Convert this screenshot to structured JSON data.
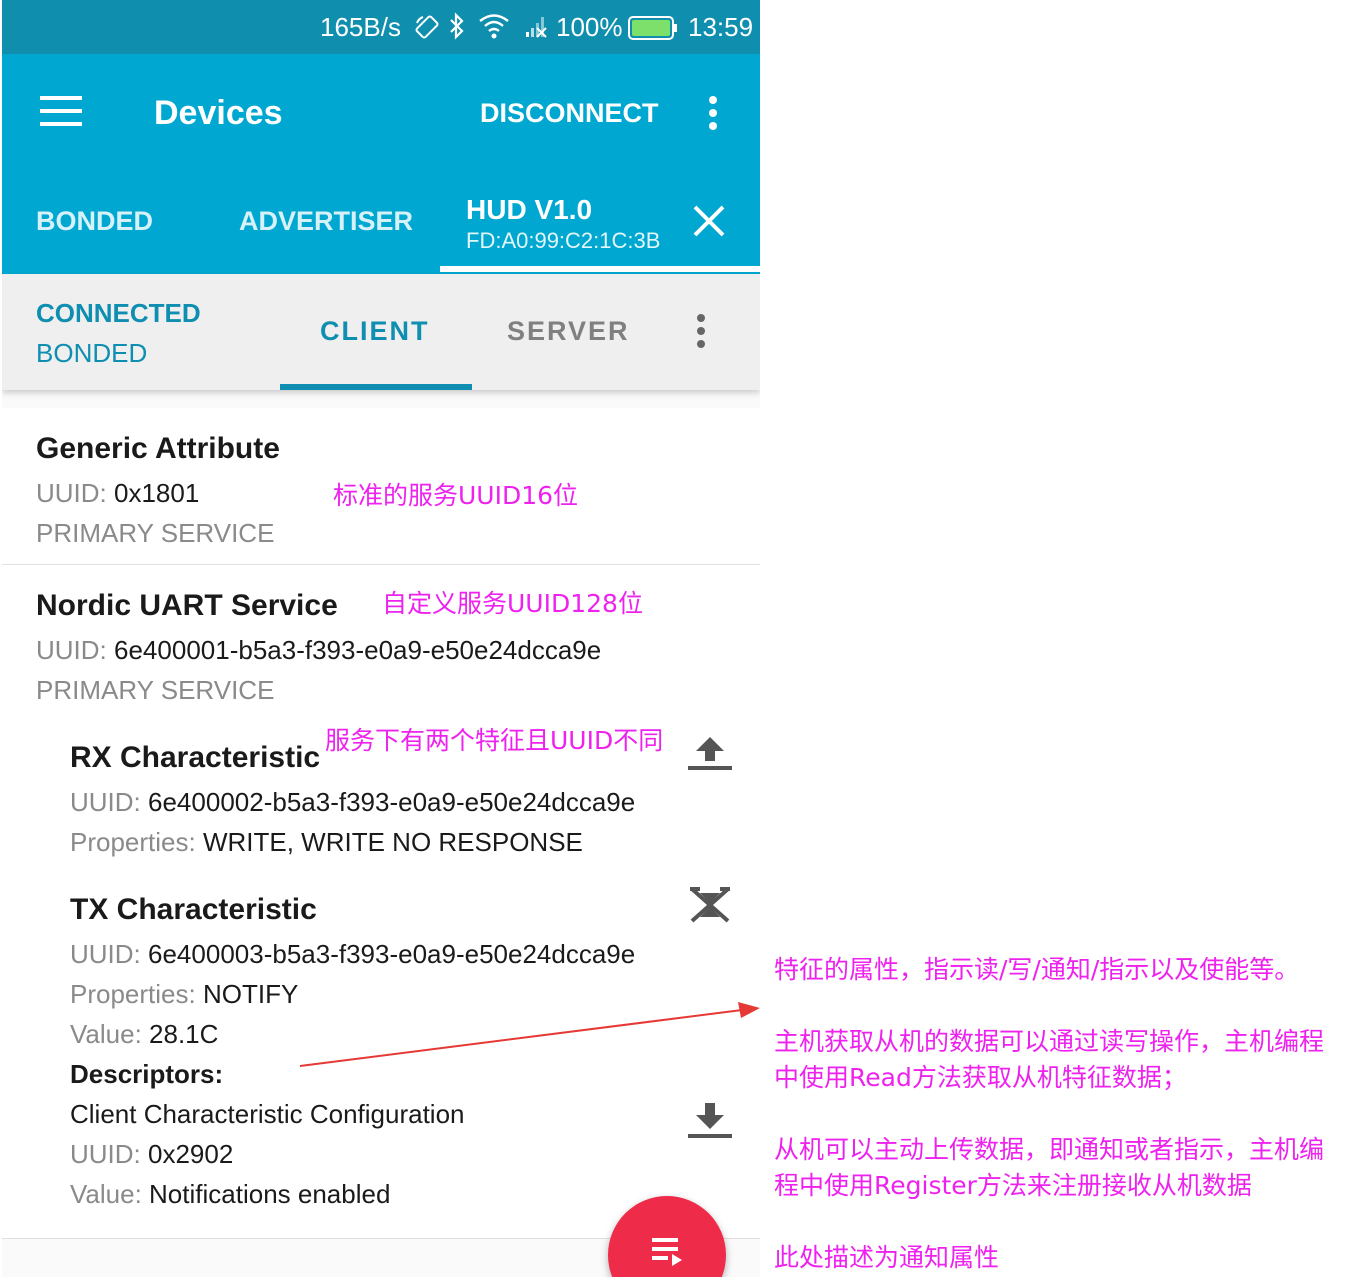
{
  "status_bar": {
    "net_speed": "165B/s",
    "battery": "100%",
    "time": "13:59",
    "bar_color": "#0f8eae"
  },
  "app_bar": {
    "title": "Devices",
    "disconnect_label": "DISCONNECT",
    "color": "#00a8d1",
    "device_tabs": [
      {
        "label": "BONDED"
      },
      {
        "label": "ADVERTISER"
      }
    ],
    "active_device": {
      "name": "HUD V1.0",
      "address": "FD:A0:99:C2:1C:3B"
    }
  },
  "connection": {
    "state": "CONNECTED",
    "bond_state": "BONDED",
    "tabs": [
      {
        "label": "CLIENT",
        "selected": true
      },
      {
        "label": "SERVER",
        "selected": false
      }
    ],
    "accent": "#0e8eb0"
  },
  "services": [
    {
      "name": "Generic Attribute",
      "uuid_label": "UUID:",
      "uuid": "0x1801",
      "type": "PRIMARY SERVICE"
    },
    {
      "name": "Nordic UART Service",
      "uuid_label": "UUID:",
      "uuid": "6e400001-b5a3-f393-e0a9-e50e24dcca9e",
      "type": "PRIMARY SERVICE",
      "characteristics": [
        {
          "name": "RX Characteristic",
          "uuid_label": "UUID:",
          "uuid": "6e400002-b5a3-f393-e0a9-e50e24dcca9e",
          "properties_label": "Properties:",
          "properties": "WRITE, WRITE NO RESPONSE",
          "action_icon": "upload-icon"
        },
        {
          "name": "TX Characteristic",
          "uuid_label": "UUID:",
          "uuid": "6e400003-b5a3-f393-e0a9-e50e24dcca9e",
          "properties_label": "Properties:",
          "properties": "NOTIFY",
          "value_label": "Value:",
          "value": "28.1C",
          "action_icon": "notifications-off-icon",
          "descriptors_label": "Descriptors:",
          "descriptors": [
            {
              "name": "Client Characteristic Configuration",
              "uuid_label": "UUID:",
              "uuid": "0x2902",
              "value_label": "Value:",
              "value": "Notifications enabled",
              "action_icon": "download-icon"
            }
          ]
        }
      ]
    }
  ],
  "fab": {
    "icon": "log-icon",
    "color": "#ee2c4a"
  },
  "annotations": {
    "color": "#ee22ee",
    "standard_service": "标准的服务UUID16位",
    "custom_service": "自定义服务UUID128位",
    "two_characteristics": "服务下有两个特征且UUID不同",
    "properties_note": "特征的属性，指示读/写/通知/指示以及使能等。",
    "read_note_1": "主机获取从机的数据可以通过读写操作，主机编程",
    "read_note_2": "中使用Read方法获取从机特征数据；",
    "notify_note_1": "从机可以主动上传数据，即通知或者指示，主机编",
    "notify_note_2": "程中使用Register方法来注册接收从机数据",
    "summary_note": "此处描述为通知属性",
    "arrow_color": "#e53935"
  }
}
